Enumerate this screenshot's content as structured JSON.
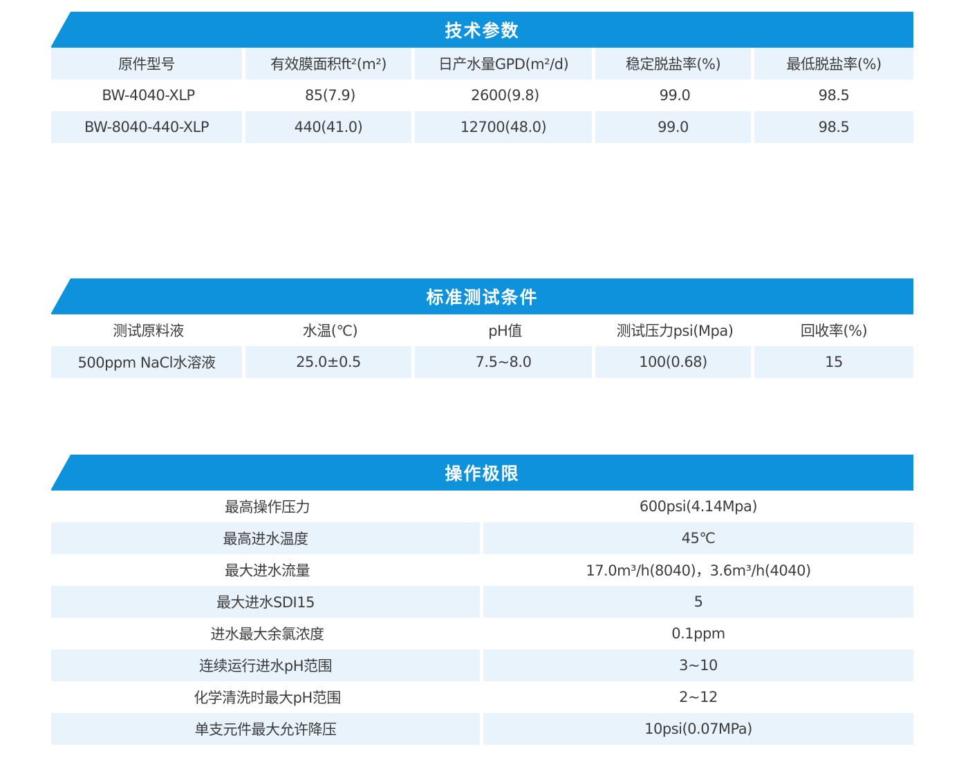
{
  "tech_params": {
    "title": "技术参数",
    "headers": [
      "原件型号",
      "有效膜面积ft²(m²)",
      "日产水量GPD(m²/d)",
      "稳定脱盐率(%)",
      "最低脱盐率(%)"
    ],
    "rows": [
      [
        "BW-4040-XLP",
        "85(7.9)",
        "2600(9.8)",
        "99.0",
        "98.5"
      ],
      [
        "BW-8040-440-XLP",
        "440(41.0)",
        "12700(48.0)",
        "99.0",
        "98.5"
      ]
    ]
  },
  "test_conditions": {
    "title": "标准测试条件",
    "headers": [
      "测试原料液",
      "水温(℃)",
      "pH值",
      "测试压力psi(Mpa)",
      "回收率(%)"
    ],
    "rows": [
      [
        "500ppm NaCl水溶液",
        "25.0±0.5",
        "7.5~8.0",
        "100(0.68)",
        "15"
      ]
    ]
  },
  "limits": {
    "title": "操作极限",
    "rows": [
      [
        "最高操作压力",
        "600psi(4.14Mpa)"
      ],
      [
        "最高进水温度",
        "45℃"
      ],
      [
        "最大进水流量",
        "17.0m³/h(8040)，3.6m³/h(4040)"
      ],
      [
        "最大进水SDI15",
        "5"
      ],
      [
        "进水最大余氯浓度",
        "0.1ppm"
      ],
      [
        "连续运行进水pH范围",
        "3~10"
      ],
      [
        "化学清洗时最大pH范围",
        "2~12"
      ],
      [
        "单支元件最大允许降压",
        "10psi(0.07MPa)"
      ]
    ]
  },
  "colors": {
    "banner": "#0d92db",
    "row_shade": "#e9f3fb"
  }
}
